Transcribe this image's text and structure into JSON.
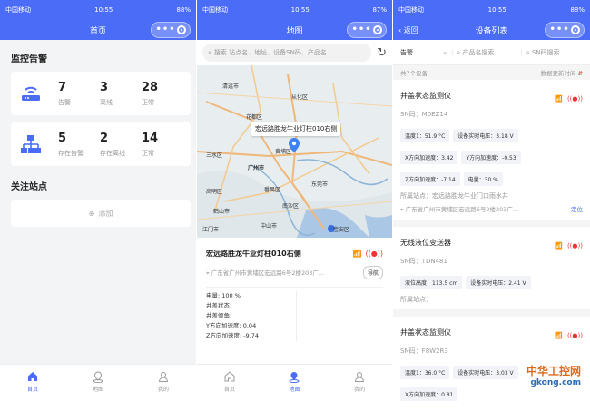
{
  "status": {
    "s1": {
      "carrier": "中国移动",
      "time": "10:55",
      "battery": "88%"
    },
    "s2": {
      "carrier": "中国移动",
      "time": "10:55",
      "battery": "87%"
    },
    "s3": {
      "carrier": "中国移动",
      "time": "10:55",
      "battery": "88%"
    }
  },
  "home": {
    "nav_title": "首页",
    "alarm_title": "监控告警",
    "cards": [
      {
        "icon": "router-icon",
        "stats": [
          {
            "n": "7",
            "l": "告警"
          },
          {
            "n": "3",
            "l": "离线"
          },
          {
            "n": "28",
            "l": "正常"
          }
        ]
      },
      {
        "icon": "network-icon",
        "stats": [
          {
            "n": "5",
            "l": "存在告警"
          },
          {
            "n": "2",
            "l": "存在离线"
          },
          {
            "n": "14",
            "l": "正常"
          }
        ]
      }
    ],
    "follow_title": "关注站点",
    "add_label": "添加"
  },
  "mapview": {
    "nav_title": "地图",
    "search_placeholder": "搜索 站点名、地址、设备SN码、产品名",
    "bubble": "宏远路胜龙牛业灯柱010右侧",
    "labels": [
      "清远市",
      "从化区",
      "花都区",
      "三水区",
      "广州市",
      "黄埔区",
      "东莞市",
      "高明区",
      "番禺区",
      "南沙区",
      "鹤山市",
      "江门市",
      "中山市",
      "宝安区"
    ],
    "detail": {
      "title": "宏远路胜龙牛业灯柱010右侧",
      "address": "广东省广州市黄埔区宏远路6号2楼203广...",
      "nav_btn": "导航",
      "lines": [
        "电量: 100 %",
        "井盖状态:",
        "井盖倾角:",
        "Y方向加速度: 0.04",
        "Z方向加速度: -9.74"
      ]
    }
  },
  "devlist": {
    "back_label": "返回",
    "nav_title": "设备列表",
    "filter": {
      "alarm": "告警",
      "product": "产品名搜索",
      "sn": "SN码搜索"
    },
    "count": "共7个设备",
    "sort_label": "数据更新时间",
    "devices": [
      {
        "name": "井盖状态监测仪",
        "sn": "SN码：M0EZ14",
        "chips": [
          "温度1：51.9 °C",
          "设备实时电压：3.18 V",
          "X方向加速度：3.42",
          "Y方向加速度：-0.53",
          "Z方向加速度：-7.14",
          "电量：30 %"
        ],
        "site": "所属站点：宏远路胜龙牛业门口雨水井",
        "address": "广东省广州市黄埔区宏远路6号2楼203广...",
        "locate": "定位"
      },
      {
        "name": "无线液位变送器",
        "sn": "SN码：TDN481",
        "chips": [
          "液位高度：113.5 cm",
          "设备实时电压：2.41 V"
        ],
        "site": "所属站点：",
        "address": "",
        "locate": ""
      },
      {
        "name": "井盖状态监测仪",
        "sn": "SN码：F8W2R3",
        "chips": [
          "温度1：36.0 °C",
          "设备实时电压：3.03 V",
          "X方向加速度：0.81"
        ],
        "site": "",
        "address": "",
        "locate": ""
      }
    ]
  },
  "tabs": [
    {
      "label": "首页",
      "icon": "home-icon"
    },
    {
      "label": "地图",
      "icon": "map-icon"
    },
    {
      "label": "我的",
      "icon": "user-icon"
    }
  ],
  "watermark": {
    "title": "中华工控网",
    "url": "gkong.com"
  }
}
